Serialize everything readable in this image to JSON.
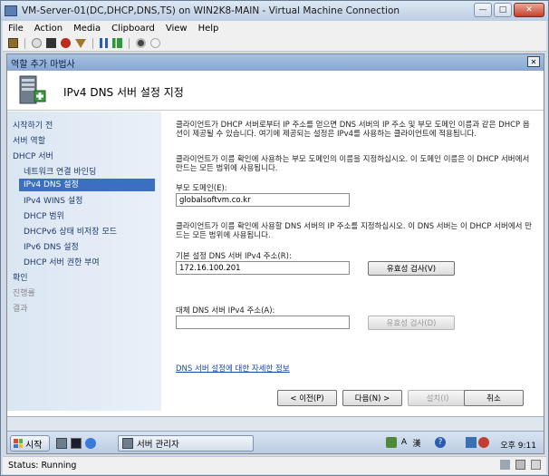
{
  "window": {
    "title": "VM-Server-01(DC,DHCP,DNS,TS) on WIN2K8-MAIN - Virtual Machine Connection"
  },
  "menubar": {
    "items": [
      "File",
      "Action",
      "Media",
      "Clipboard",
      "View",
      "Help"
    ]
  },
  "wizard": {
    "window_title": "역할 추가 마법사",
    "page_title": "IPv4 DNS 서버 설정 지정",
    "nav": [
      {
        "label": "시작하기 전",
        "state": "normal",
        "level": 0
      },
      {
        "label": "서버 역할",
        "state": "normal",
        "level": 0
      },
      {
        "label": "DHCP 서버",
        "state": "normal",
        "level": 0
      },
      {
        "label": "네트워크 연결 바인딩",
        "state": "normal",
        "level": 1
      },
      {
        "label": "IPv4 DNS 설정",
        "state": "selected",
        "level": 1
      },
      {
        "label": "IPv4 WINS 설정",
        "state": "normal",
        "level": 1
      },
      {
        "label": "DHCP 범위",
        "state": "normal",
        "level": 1
      },
      {
        "label": "DHCPv6 상태 비저장 모드",
        "state": "normal",
        "level": 1
      },
      {
        "label": "IPv6 DNS 설정",
        "state": "normal",
        "level": 1
      },
      {
        "label": "DHCP 서버 권한 부여",
        "state": "normal",
        "level": 1
      },
      {
        "label": "확인",
        "state": "normal",
        "level": 0
      },
      {
        "label": "진행률",
        "state": "disabled",
        "level": 0
      },
      {
        "label": "결과",
        "state": "disabled",
        "level": 0
      }
    ],
    "intro_text": "클라이언트가 DHCP 서버로부터 IP 주소를 얻으면 DNS 서버의 IP 주소 및 부모 도메인 이름과 같은 DHCP 옵션이 제공될 수 있습니다. 여기에 제공되는 설정은 IPv4를 사용하는 클라이언트에 적용됩니다.",
    "domain_text": "클라이언트가 이름 확인에 사용하는 부모 도메인의 이름을 지정하십시오. 이 도메인 이름은 이 DHCP 서버에서 만드는 모든 범위에 사용됩니다.",
    "parent_domain_label": "부모 도메인(E):",
    "parent_domain_value": "globalsoftvm.co.kr",
    "dns_text": "클라이언트가 이름 확인에 사용할 DNS 서버의 IP 주소를 지정하십시오. 이 DNS 서버는 이 DHCP 서버에서 만드는 모든 범위에 사용됩니다.",
    "preferred_dns_label": "기본 설정 DNS 서버 IPv4 주소(R):",
    "preferred_dns_value": "172.16.100.201",
    "validate_button_1": "유효성 검사(V)",
    "alternate_dns_label": "대체 DNS 서버 IPv4 주소(A):",
    "alternate_dns_value": "",
    "validate_button_2": "유효성 검사(D)",
    "more_info_link": "DNS 서버 설정에 대한 자세한 정보",
    "buttons": {
      "back": "< 이전(P)",
      "next": "다음(N) >",
      "install": "설치(I)",
      "cancel": "취소"
    }
  },
  "taskbar": {
    "start_label": "시작",
    "task_label": "서버 관리자",
    "clock": "오후 9:11",
    "ime_indicator": "A",
    "hangul_indicator": "漢"
  },
  "status_bar": {
    "status": "Status: Running"
  },
  "colors": {
    "selected_nav": "#3b6fbf",
    "link": "#1646b4",
    "nav_background": "#dbe6f3"
  }
}
